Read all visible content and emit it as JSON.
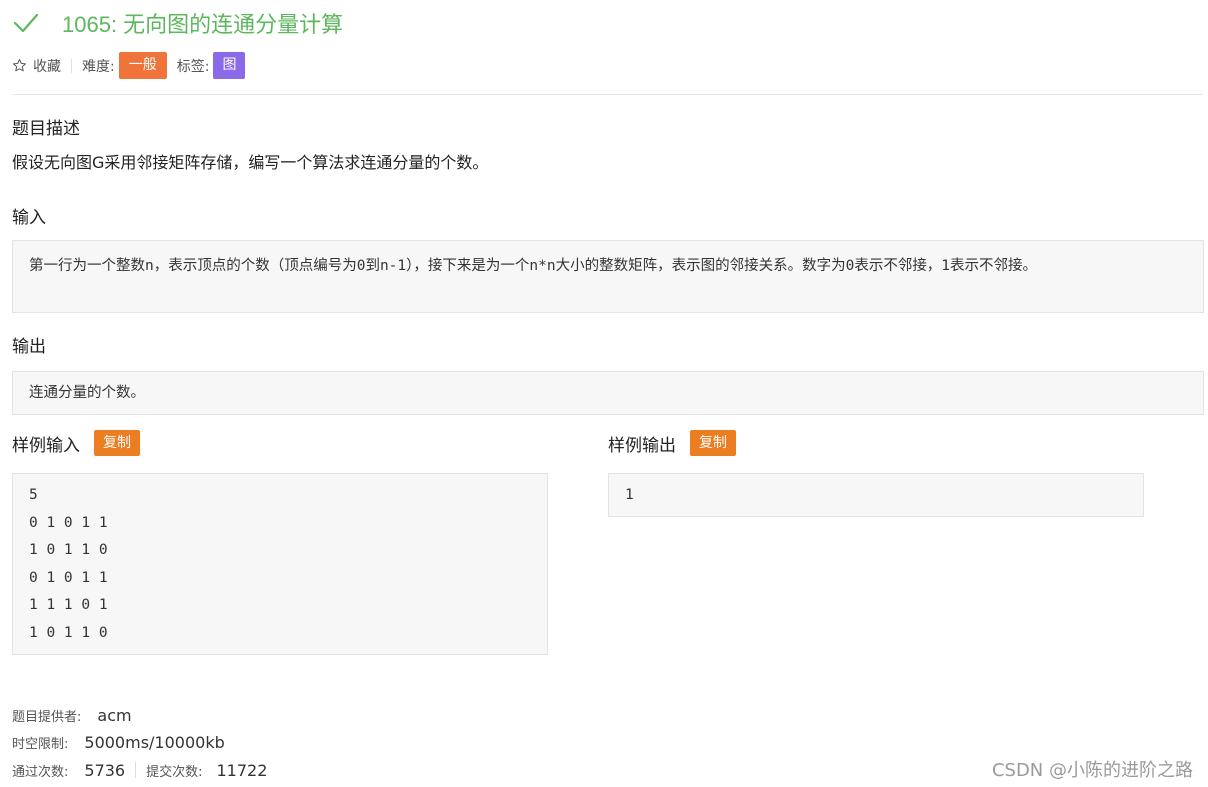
{
  "problem": {
    "title": "1065: 无向图的连通分量计算",
    "favorite_label": "收藏",
    "difficulty_label": "难度:",
    "difficulty_value": "一般",
    "tags_label": "标签:",
    "tag_value": "图"
  },
  "sections": {
    "description_title": "题目描述",
    "description_text": "假设无向图G采用邻接矩阵存储，编写一个算法求连通分量的个数。",
    "input_title": "输入",
    "input_text": "第一行为一个整数n，表示顶点的个数（顶点编号为0到n-1），接下来是为一个n*n大小的整数矩阵，表示图的邻接关系。数字为0表示不邻接，1表示不邻接。",
    "output_title": "输出",
    "output_text": "连通分量的个数。"
  },
  "samples": {
    "input_title": "样例输入",
    "output_title": "样例输出",
    "copy_label": "复制",
    "input_lines": [
      "5",
      "0 1 0 1 1",
      "1 0 1 1 0",
      "0 1 0 1 1",
      "1 1 1 0 1",
      "1 0 1 1 0"
    ],
    "output_lines": [
      "1"
    ]
  },
  "footer": {
    "provider_label": "题目提供者:",
    "provider_value": "acm",
    "limit_label": "时空限制:",
    "limit_value": "5000ms/10000kb",
    "accepted_label": "通过次数:",
    "accepted_value": "5736",
    "submitted_label": "提交次数:",
    "submitted_value": "11722"
  },
  "watermark": "CSDN @小陈的进阶之路",
  "colors": {
    "title_green": "#5cb85c",
    "difficulty_orange": "#f0743a",
    "tag_purple": "#8a6ae8",
    "copy_orange": "#ec7e22"
  },
  "icons": {
    "check": "check-icon",
    "star": "star-outline-icon"
  }
}
